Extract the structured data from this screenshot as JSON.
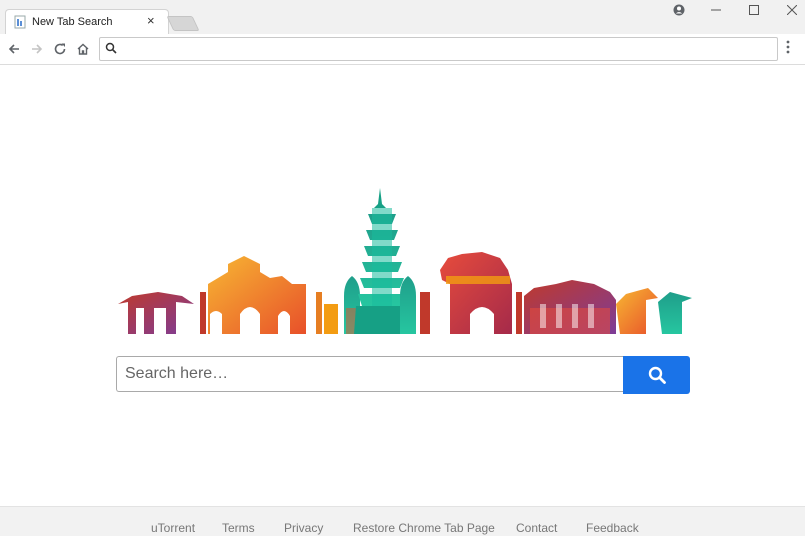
{
  "tab": {
    "title": "New Tab Search",
    "close": "×"
  },
  "omnibox": {
    "value": "",
    "placeholder": ""
  },
  "search": {
    "placeholder": "Search here…",
    "button_color": "#1a73e8"
  },
  "footer": {
    "links": [
      "uTorrent",
      "Terms",
      "Privacy",
      "Restore Chrome Tab Page",
      "Contact",
      "Feedback"
    ]
  },
  "icons": [
    "favicon-icon",
    "close-icon",
    "profile-icon",
    "minimize-icon",
    "maximize-icon",
    "window-close-icon",
    "back-arrow-icon",
    "forward-arrow-icon",
    "reload-icon",
    "home-icon",
    "search-icon",
    "menu-dots-icon"
  ],
  "colors": {
    "accent": "#1a73e8",
    "footer_bg": "#f2f2f2",
    "skyline": [
      "#f39c12",
      "#e74c3c",
      "#c0392b",
      "#16a085",
      "#8e44ad",
      "#f1c40f",
      "#d35400"
    ]
  }
}
